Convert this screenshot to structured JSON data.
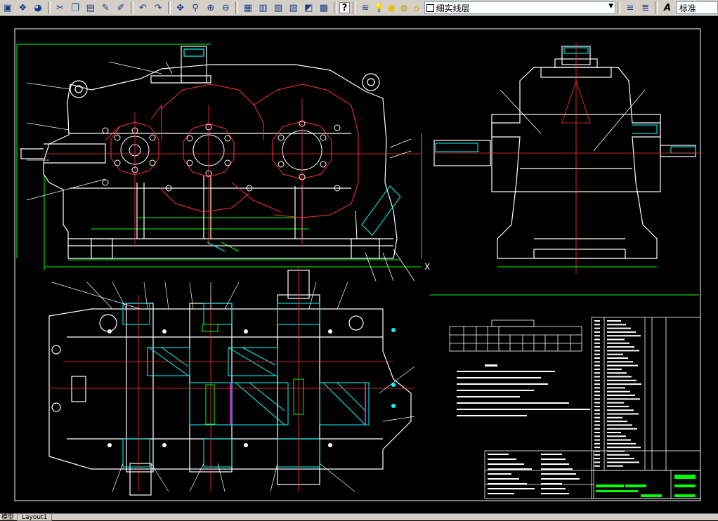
{
  "toolbar": {
    "buttons": [
      {
        "name": "layer-manager-icon",
        "glyph": "▣"
      },
      {
        "name": "plot-icon",
        "glyph": "❖"
      },
      {
        "name": "publish-icon",
        "glyph": "◕"
      },
      {
        "name": "cut-icon",
        "glyph": "✂"
      },
      {
        "name": "copy-icon",
        "glyph": "❐"
      },
      {
        "name": "paste-icon",
        "glyph": "▤"
      },
      {
        "name": "match-properties-icon",
        "glyph": "✎"
      },
      {
        "name": "block-editor-icon",
        "glyph": "✐"
      },
      {
        "name": "undo-icon",
        "glyph": "↶"
      },
      {
        "name": "redo-icon",
        "glyph": "↷"
      },
      {
        "name": "pan-icon",
        "glyph": "✥"
      },
      {
        "name": "zoom-realtime-icon",
        "glyph": "⚲"
      },
      {
        "name": "zoom-window-icon",
        "glyph": "⊕"
      },
      {
        "name": "zoom-previous-icon",
        "glyph": "⊖"
      },
      {
        "name": "properties-icon",
        "glyph": "▦"
      },
      {
        "name": "design-center-icon",
        "glyph": "▥"
      },
      {
        "name": "tool-palettes-icon",
        "glyph": "▧"
      },
      {
        "name": "sheet-set-icon",
        "glyph": "▨"
      },
      {
        "name": "markup-icon",
        "glyph": "◩"
      },
      {
        "name": "calculator-icon",
        "glyph": "▩"
      },
      {
        "name": "help-icon",
        "glyph": "?"
      }
    ],
    "layer_state_icon": "layers-stack-icon",
    "layer_dropdown_value": "细实线层",
    "style_dropdown_value": "标准"
  },
  "status": {
    "model_tab": "模型",
    "layout_tab": "Layout1"
  },
  "colors": {
    "background": "#000000",
    "outline": "#ffffff",
    "centerline": "#ff0000",
    "dimension": "#00ff00",
    "hatch": "#00ffff",
    "gear": "#ff3333",
    "text": "#ffffff"
  },
  "drawing": {
    "table_main_rows": 40,
    "tech_notes_count": 9
  }
}
